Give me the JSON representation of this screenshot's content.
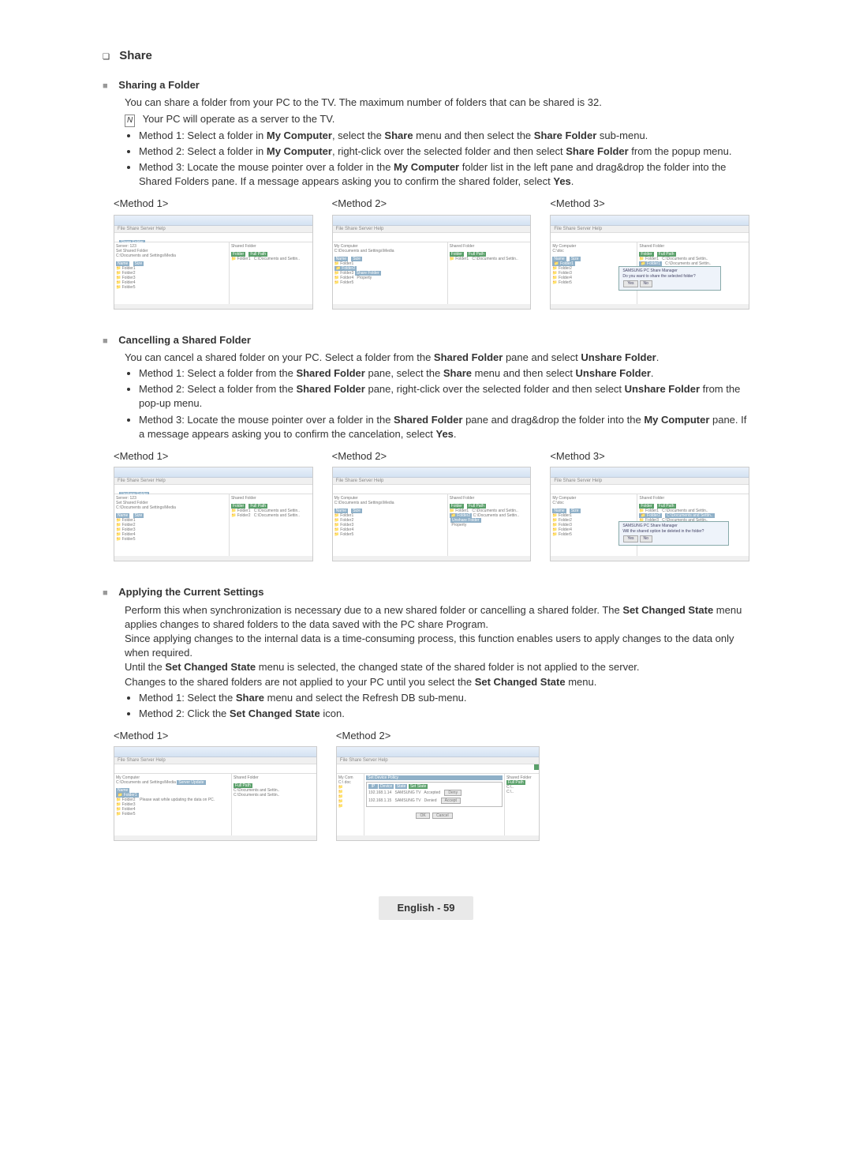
{
  "section_title": "Share",
  "sharing": {
    "heading": "Sharing a Folder",
    "intro": "You can share a folder from your PC to the TV. The maximum number of folders that can be shared is 32.",
    "note": "Your PC will operate as a server to the TV.",
    "m1_a": "Method 1: Select a folder in ",
    "m1_b": "My Computer",
    "m1_c": ", select the ",
    "m1_d": "Share",
    "m1_e": " menu and then select the ",
    "m1_f": "Share Folder",
    "m1_g": " sub-menu.",
    "m2_a": "Method 2: Select a folder in ",
    "m2_b": "My Computer",
    "m2_c": ", right-click over the selected folder and then select ",
    "m2_d": "Share Folder",
    "m2_e": " from the popup menu.",
    "m3_a": "Method 3: Locate the mouse pointer over a folder in the ",
    "m3_b": "My Computer",
    "m3_c": " folder list in the left pane and drag&drop the folder into the Shared Folders pane. If a message appears asking you to confirm the shared folder, select ",
    "m3_d": "Yes",
    "m3_e": ".",
    "method1_label": "<Method 1>",
    "method2_label": "<Method 2>",
    "method3_label": "<Method 3>"
  },
  "cancelling": {
    "heading": "Cancelling a Shared Folder",
    "intro_a": "You can cancel a shared folder on your PC. Select a folder from the ",
    "intro_b": "Shared Folder",
    "intro_c": " pane and select ",
    "intro_d": "Unshare Folder",
    "intro_e": ".",
    "m1_a": "Method 1: Select a folder from the ",
    "m1_b": "Shared Folder",
    "m1_c": " pane, select the ",
    "m1_d": "Share",
    "m1_e": " menu and then select ",
    "m1_f": "Unshare Folder",
    "m1_g": ".",
    "m2_a": "Method 2: Select a folder from the ",
    "m2_b": "Shared Folder",
    "m2_c": " pane, right-click over the selected folder and then select ",
    "m2_d": "Unshare Folder",
    "m2_e": " from the pop-up menu.",
    "m3_a": "Method 3: Locate the mouse pointer over a folder in the ",
    "m3_b": "Shared Folder",
    "m3_c": " pane and drag&drop the folder into the ",
    "m3_d": "My Computer",
    "m3_e": " pane. If a message appears asking you to confirm the cancelation, select ",
    "m3_f": "Yes",
    "m3_g": ".",
    "method1_label": "<Method 1>",
    "method2_label": "<Method 2>",
    "method3_label": "<Method 3>"
  },
  "applying": {
    "heading": "Applying the Current Settings",
    "p1_a": "Perform this when synchronization is necessary due to a new shared folder or cancelling a shared folder. The ",
    "p1_b": "Set Changed State",
    "p1_c": " menu applies changes to shared folders to the data saved with the PC share Program.",
    "p2": "Since applying changes to the internal data is a time-consuming process, this function enables users to apply changes to the data only when required.",
    "p3_a": "Until the ",
    "p3_b": "Set Changed State",
    "p3_c": " menu is selected, the changed state of the shared folder is not applied to the server.",
    "p4_a": "Changes to the shared folders are not applied to your PC until you select the ",
    "p4_b": "Set Changed State",
    "p4_c": " menu.",
    "m1_a": "Method 1: Select the ",
    "m1_b": "Share",
    "m1_c": " menu and select the Refresh DB sub-menu.",
    "m2_a": "Method 2: Click the ",
    "m2_b": "Set Changed State",
    "m2_c": " icon.",
    "method1_label": "<Method 1>",
    "method2_label": "<Method 2>"
  },
  "footer": {
    "lang": "English - ",
    "page": "59"
  }
}
